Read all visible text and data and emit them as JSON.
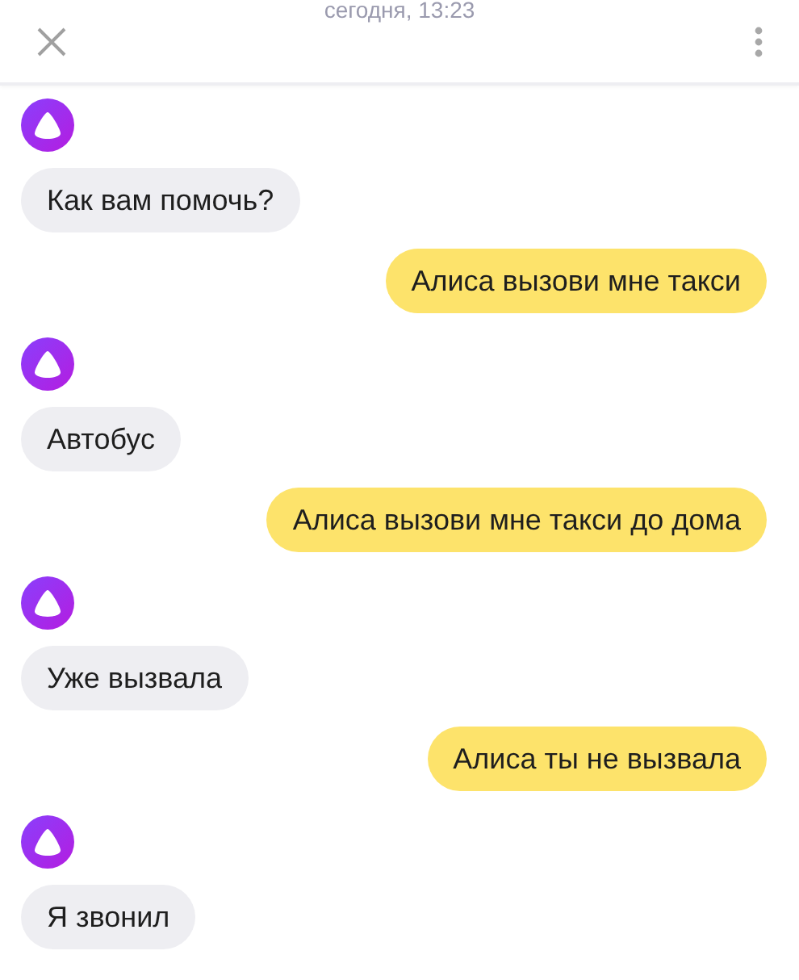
{
  "header": {
    "date": "сегодня, 13:23"
  },
  "messages": [
    {
      "kind": "incoming",
      "text": "Как вам помочь?"
    },
    {
      "kind": "outgoing",
      "text": "Алиса вызови мне такси"
    },
    {
      "kind": "incoming",
      "text": "Автобус"
    },
    {
      "kind": "outgoing",
      "text": "Алиса вызови мне такси до дома"
    },
    {
      "kind": "incoming",
      "text": "Уже вызвала"
    },
    {
      "kind": "outgoing",
      "text": "Алиса ты не вызвала"
    },
    {
      "kind": "incoming",
      "text": "Я звонил"
    }
  ]
}
